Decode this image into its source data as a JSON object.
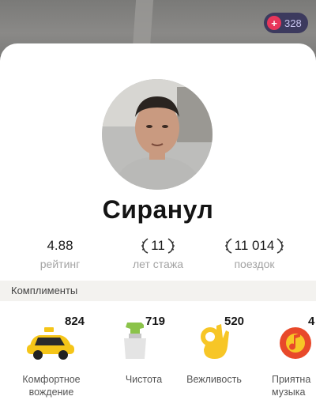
{
  "header": {
    "points_badge": "328"
  },
  "profile": {
    "name": "Сиранул",
    "stats": [
      {
        "value": "4.88",
        "label": "рейтинг"
      },
      {
        "value": "11",
        "label": "лет стажа"
      },
      {
        "value": "11 014",
        "label": "поездок"
      }
    ]
  },
  "compliments": {
    "title": "Комплименты",
    "items": [
      {
        "count": "824",
        "label_line1": "Комфортное",
        "label_line2": "вождение",
        "icon": "yellow-taxi-icon"
      },
      {
        "count": "719",
        "label_line1": "Чистота",
        "label_line2": "",
        "icon": "spray-bottle-icon"
      },
      {
        "count": "520",
        "label_line1": "Вежливость",
        "label_line2": "",
        "icon": "ok-hand-icon"
      },
      {
        "count": "4",
        "label_line1": "Приятна",
        "label_line2": "музыка",
        "icon": "music-note-icon"
      }
    ]
  },
  "colors": {
    "badge_bg": "#3c3a5e",
    "badge_icon": "#e8365a",
    "accent_yellow": "#f5c518"
  }
}
